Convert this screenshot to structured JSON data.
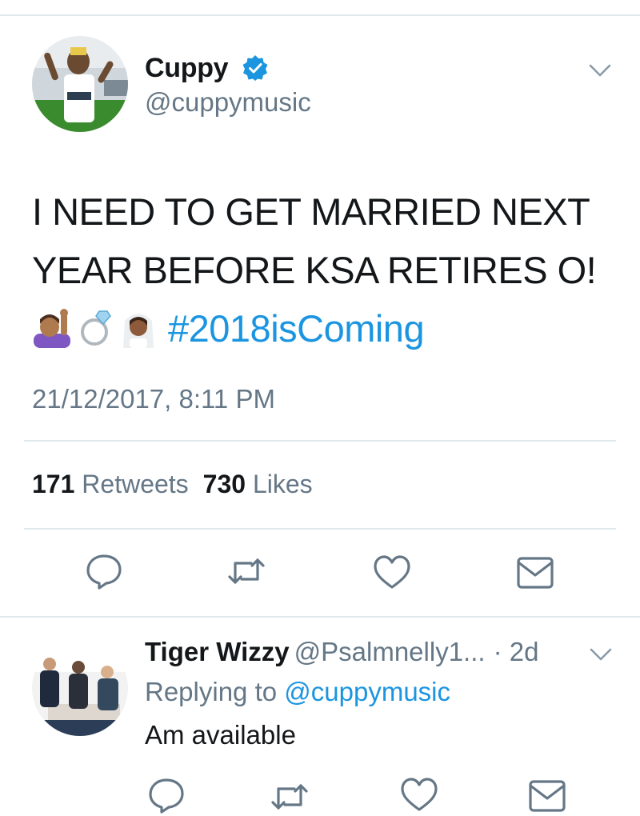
{
  "tweet": {
    "author_name": "Cuppy",
    "author_handle": "@cuppymusic",
    "verified": true,
    "text_line_1": "I NEED TO GET MARRIED NEXT",
    "text_line_2": "YEAR BEFORE KSA RETIRES O!",
    "emojis": [
      "raising-hand-emoji",
      "ring-emoji",
      "bride-with-veil-emoji"
    ],
    "hashtag": "#2018isComing",
    "timestamp": "21/12/2017, 8:11 PM",
    "retweets_count": "171",
    "retweets_label": "Retweets",
    "likes_count": "730",
    "likes_label": "Likes"
  },
  "actions": [
    "reply-icon",
    "retweet-icon",
    "like-icon",
    "direct-message-icon"
  ],
  "reply": {
    "author_name": "Tiger Wizzy",
    "author_handle": "@Psalmnelly1...",
    "time": "· 2d",
    "replying_prefix": "Replying to",
    "replying_to": "@cuppymusic",
    "text": "Am available"
  },
  "colors": {
    "link": "#1b95e0",
    "secondary_text": "#657786",
    "primary_text": "#14171a",
    "divider": "#e1e8ed",
    "icon": "#657786"
  }
}
